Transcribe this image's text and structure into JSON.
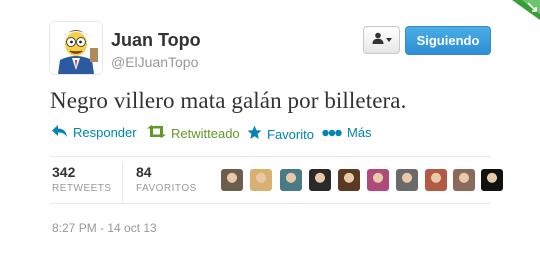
{
  "user": {
    "display_name": "Juan Topo",
    "screen_name": "@ElJuanTopo",
    "avatar_icon": "cartoon-character-avatar"
  },
  "header": {
    "user_menu_icon": "person-dropdown-icon",
    "follow_label": "Siguiendo"
  },
  "tweet": {
    "text": "Negro villero mata galán por billetera."
  },
  "actions": [
    {
      "label": "Responder",
      "icon": "reply-icon"
    },
    {
      "label": "Retwitteado",
      "icon": "retweet-icon"
    },
    {
      "label": "Favorito",
      "icon": "star-icon"
    },
    {
      "label": "Más",
      "icon": "more-dots-icon"
    }
  ],
  "stats": {
    "retweets_count": "342",
    "retweets_label": "RETWEETS",
    "favorites_count": "84",
    "favorites_label": "FAVORITOS"
  },
  "avatars": [
    {
      "name": "favoriter-avatar-1",
      "color": "#6b5e4e"
    },
    {
      "name": "favoriter-avatar-2",
      "color": "#d8b070"
    },
    {
      "name": "favoriter-avatar-3",
      "color": "#4a7a86"
    },
    {
      "name": "favoriter-avatar-4",
      "color": "#2a2a2a"
    },
    {
      "name": "favoriter-avatar-5",
      "color": "#5a3a22"
    },
    {
      "name": "favoriter-avatar-6",
      "color": "#b04a7a"
    },
    {
      "name": "favoriter-avatar-7",
      "color": "#6a6a6a"
    },
    {
      "name": "favoriter-avatar-8",
      "color": "#b25a45"
    },
    {
      "name": "favoriter-avatar-9",
      "color": "#8a6a5a"
    },
    {
      "name": "favoriter-avatar-10",
      "color": "#111111"
    }
  ],
  "timestamp": "8:27 PM - 14 oct 13",
  "colors": {
    "link": "#0084b4",
    "follow_button": "#2d8ed5",
    "muted": "#999999",
    "retweeted": "#609928"
  }
}
